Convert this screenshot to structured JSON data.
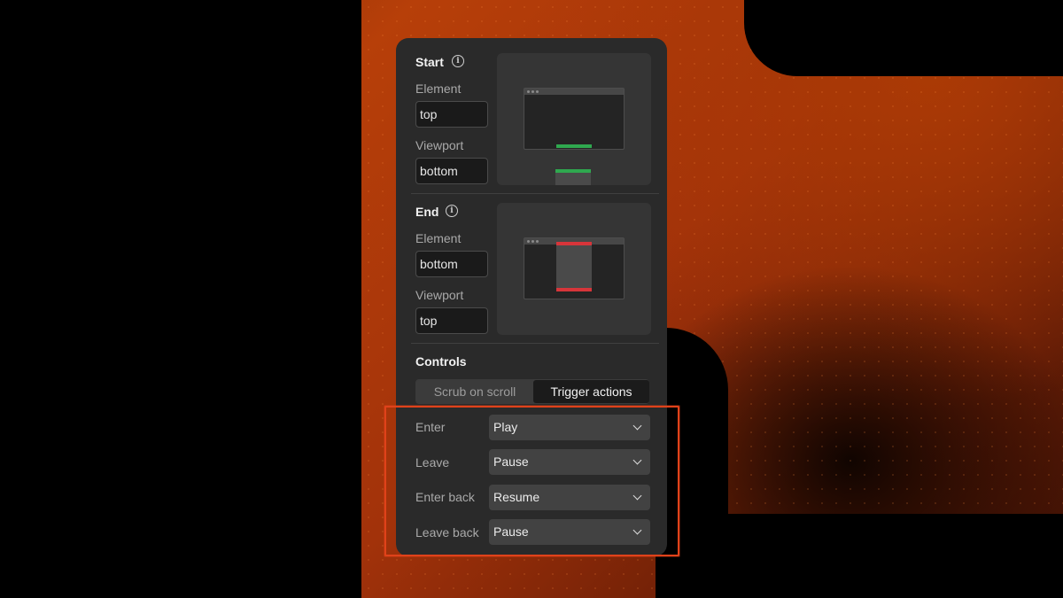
{
  "start": {
    "title": "Start",
    "element_label": "Element",
    "element_value": "top",
    "viewport_label": "Viewport",
    "viewport_value": "bottom",
    "marker_color": "#2fa84f"
  },
  "end": {
    "title": "End",
    "element_label": "Element",
    "element_value": "bottom",
    "viewport_label": "Viewport",
    "viewport_value": "top",
    "marker_color": "#d7353a"
  },
  "controls": {
    "title": "Controls",
    "modes": [
      "Scrub on scroll",
      "Trigger actions"
    ],
    "active_mode": "Trigger actions",
    "actions": [
      {
        "label": "Enter",
        "value": "Play"
      },
      {
        "label": "Leave",
        "value": "Pause"
      },
      {
        "label": "Enter back",
        "value": "Resume"
      },
      {
        "label": "Leave back",
        "value": "Pause"
      }
    ]
  },
  "icons": {
    "info": "info-circle-icon",
    "dropdown": "chevron-down-icon"
  },
  "colors": {
    "accent_highlight": "#e0421a",
    "panel_bg": "#2a2a2a"
  }
}
